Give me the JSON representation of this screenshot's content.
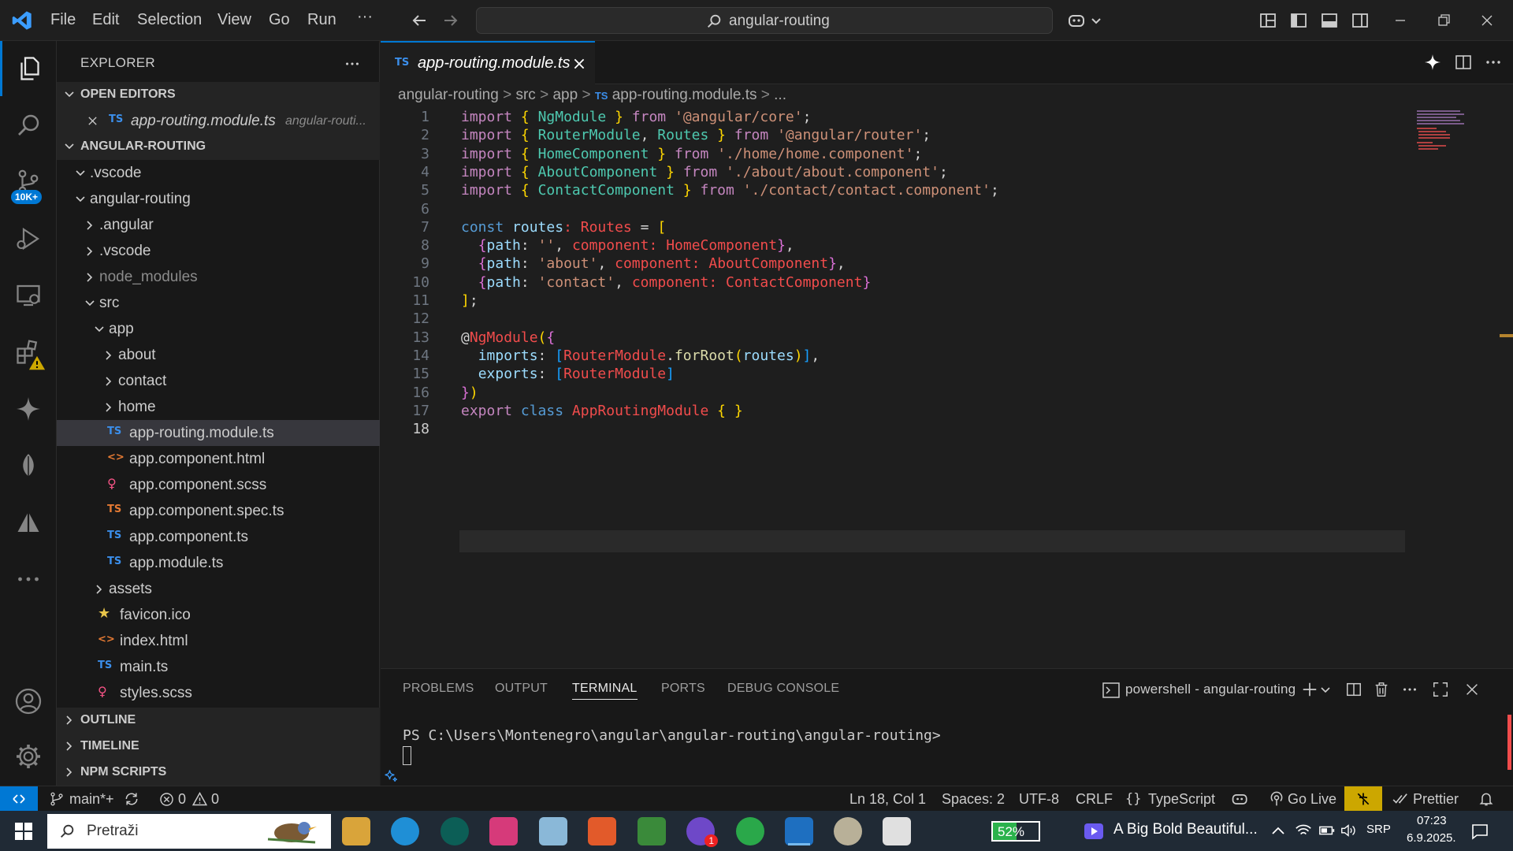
{
  "titlebar": {
    "menus": [
      "File",
      "Edit",
      "Selection",
      "View",
      "Go",
      "Run",
      "···"
    ],
    "search_text": "angular-routing"
  },
  "activity": {
    "scm_badge": "10K+"
  },
  "sidebar": {
    "title": "EXPLORER",
    "open_editors_label": "OPEN EDITORS",
    "open_editor": {
      "name": "app-routing.module.ts",
      "path": "angular-routi..."
    },
    "project_label": "ANGULAR-ROUTING",
    "tree": [
      {
        "label": ".vscode",
        "kind": "folder-open",
        "depth": 0
      },
      {
        "label": "angular-routing",
        "kind": "folder-open",
        "depth": 0
      },
      {
        "label": ".angular",
        "kind": "folder",
        "depth": 1
      },
      {
        "label": ".vscode",
        "kind": "folder",
        "depth": 1
      },
      {
        "label": "node_modules",
        "kind": "folder",
        "depth": 1,
        "dim": true
      },
      {
        "label": "src",
        "kind": "folder-open",
        "depth": 1
      },
      {
        "label": "app",
        "kind": "folder-open",
        "depth": 2
      },
      {
        "label": "about",
        "kind": "folder",
        "depth": 3
      },
      {
        "label": "contact",
        "kind": "folder",
        "depth": 3
      },
      {
        "label": "home",
        "kind": "folder",
        "depth": 3
      },
      {
        "label": "app-routing.module.ts",
        "kind": "ts",
        "depth": 3,
        "selected": true
      },
      {
        "label": "app.component.html",
        "kind": "html",
        "depth": 3
      },
      {
        "label": "app.component.scss",
        "kind": "scss",
        "depth": 3
      },
      {
        "label": "app.component.spec.ts",
        "kind": "tsred",
        "depth": 3
      },
      {
        "label": "app.component.ts",
        "kind": "ts",
        "depth": 3
      },
      {
        "label": "app.module.ts",
        "kind": "ts",
        "depth": 3
      },
      {
        "label": "assets",
        "kind": "folder",
        "depth": 2
      },
      {
        "label": "favicon.ico",
        "kind": "star",
        "depth": 2
      },
      {
        "label": "index.html",
        "kind": "html",
        "depth": 2
      },
      {
        "label": "main.ts",
        "kind": "ts",
        "depth": 2
      },
      {
        "label": "styles.scss",
        "kind": "scss",
        "depth": 2
      }
    ],
    "bottom_sections": [
      "OUTLINE",
      "TIMELINE",
      "NPM SCRIPTS"
    ]
  },
  "editor": {
    "tab_icon": "TS",
    "tab_name": "app-routing.module.ts",
    "breadcrumb": [
      "angular-routing",
      "src",
      "app",
      "app-routing.module.ts",
      "..."
    ],
    "line_numbers": [
      "1",
      "2",
      "3",
      "4",
      "5",
      "6",
      "7",
      "8",
      "9",
      "10",
      "11",
      "12",
      "13",
      "14",
      "15",
      "16",
      "17",
      "18"
    ]
  },
  "panel": {
    "tabs": [
      "PROBLEMS",
      "OUTPUT",
      "TERMINAL",
      "PORTS",
      "DEBUG CONSOLE"
    ],
    "terminal_name": "powershell - angular-routing",
    "prompt": "PS C:\\Users\\Montenegro\\angular\\angular-routing\\angular-routing>"
  },
  "status": {
    "branch": "main*+",
    "errors": "0",
    "warnings": "0",
    "position": "Ln 18, Col 1",
    "spaces": "Spaces: 2",
    "encoding": "UTF-8",
    "eol": "CRLF",
    "language": "TypeScript",
    "golive": "Go Live",
    "prettier": "Prettier"
  },
  "taskbar": {
    "search_label": "Pretraži",
    "battery": "52%",
    "media": "A Big Bold Beautiful...",
    "lang": "SRP",
    "time": "07:23",
    "date": "6.9.2025.",
    "viber_badge": "1"
  },
  "colors": {
    "accent": "#0078d4",
    "editor_bg": "#1e1e1e",
    "sidebar_bg": "#181818"
  }
}
